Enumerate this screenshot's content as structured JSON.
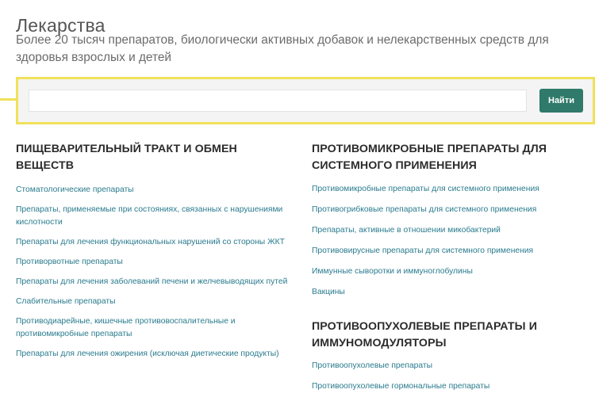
{
  "page": {
    "title": "Лекарства",
    "subtitle": "Более 20 тысяч препаратов, биологически активных добавок и нелекарственных средств для здоровья взрослых и детей"
  },
  "search": {
    "placeholder": "",
    "value": "",
    "button_label": "Найти"
  },
  "colors": {
    "accent_yellow": "#f0e15a",
    "button_green": "#2f7a6a",
    "link_teal": "#2a7b8e"
  },
  "sections": [
    {
      "heading": "ПИЩЕВАРИТЕЛЬНЫЙ ТРАКТ И ОБМЕН ВЕЩЕСТВ",
      "links": [
        "Стоматологические препараты",
        "Препараты, применяемые при состояниях, связанных с нарушениями кислотности",
        "Препараты для лечения функциональных нарушений со стороны ЖКТ",
        "Противорвотные препараты",
        "Препараты для лечения заболеваний печени и желчевыводящих путей",
        "Слабительные препараты",
        "Противодиарейные, кишечные противовоспалительные и противомикробные препараты",
        "Препараты для лечения ожирения (исключая диетические продукты)"
      ]
    },
    {
      "heading": "ПРОТИВОМИКРОБНЫЕ ПРЕПАРАТЫ ДЛЯ СИСТЕМНОГО ПРИМЕНЕНИЯ",
      "links": [
        "Противомикробные препараты для системного применения",
        "Противогрибковые препараты для системного применения",
        "Препараты, активные в отношении микобактерий",
        "Противовирусные препараты для системного применения",
        "Иммунные сыворотки и иммуноглобулины",
        "Вакцины"
      ]
    },
    {
      "heading": "ПРОТИВООПУХОЛЕВЫЕ ПРЕПАРАТЫ И ИММУНОМОДУЛЯТОРЫ",
      "links": [
        "Противоопухолевые препараты",
        "Противоопухолевые гормональные препараты"
      ]
    }
  ]
}
